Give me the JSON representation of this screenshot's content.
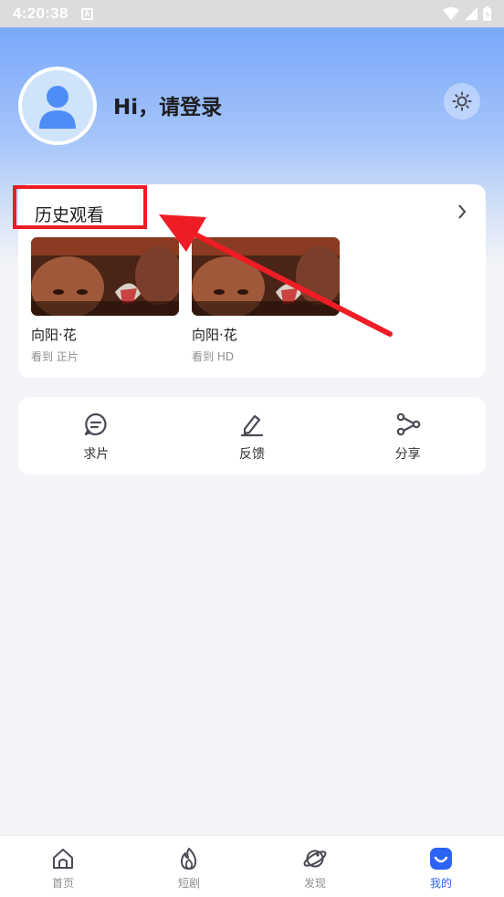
{
  "status_bar": {
    "time": "4:20:38",
    "notification_letter": "A"
  },
  "header": {
    "greeting": "Hi，请登录",
    "settings_icon": "brightness-icon"
  },
  "history": {
    "title": "历史观看",
    "items": [
      {
        "title": "向阳·花",
        "progress": "看到 正片"
      },
      {
        "title": "向阳·花",
        "progress": "看到 HD"
      }
    ]
  },
  "tools": [
    {
      "label": "求片",
      "icon": "message-icon"
    },
    {
      "label": "反馈",
      "icon": "edit-icon"
    },
    {
      "label": "分享",
      "icon": "share-icon"
    }
  ],
  "tabbar": {
    "active_color": "#2b63f5",
    "items": [
      {
        "label": "首页",
        "icon": "home-icon",
        "active": false
      },
      {
        "label": "短剧",
        "icon": "fire-icon",
        "active": false
      },
      {
        "label": "发现",
        "icon": "planet-icon",
        "active": false
      },
      {
        "label": "我的",
        "icon": "profile-icon",
        "active": true
      }
    ]
  },
  "annotation": {
    "highlight_color": "#ee1c24"
  }
}
